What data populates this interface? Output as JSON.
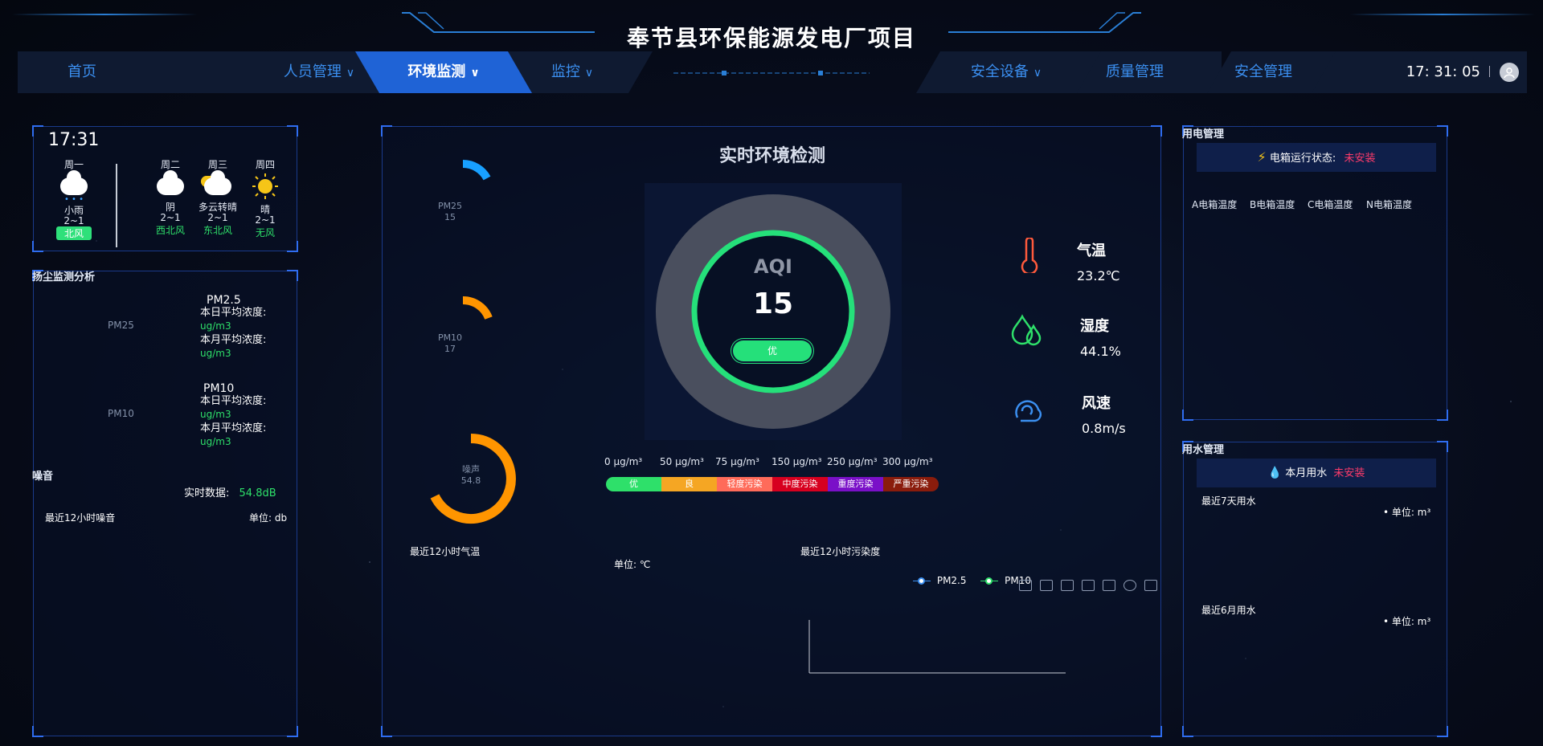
{
  "header": {
    "title": "奉节县环保能源发电厂项目",
    "time": "17: 31: 05",
    "nav": [
      {
        "label": "首页",
        "dropdown": false
      },
      {
        "label": "人员管理",
        "dropdown": true
      },
      {
        "label": "环境监测",
        "dropdown": true,
        "active": true
      },
      {
        "label": "监控",
        "dropdown": true
      },
      {
        "label": "安全设备",
        "dropdown": true
      },
      {
        "label": "质量管理",
        "dropdown": false
      },
      {
        "label": "安全管理",
        "dropdown": false
      }
    ]
  },
  "weather": {
    "time": "17:31",
    "today": {
      "day": "周一",
      "desc": "小雨",
      "temp": "2~1",
      "wind": "北风"
    },
    "forecast": [
      {
        "day": "周二",
        "desc": "阴",
        "temp": "2~1",
        "wind": "西北风"
      },
      {
        "day": "周三",
        "desc": "多云转晴",
        "temp": "2~1",
        "wind": "东北风"
      },
      {
        "day": "周四",
        "desc": "晴",
        "temp": "2~1",
        "wind": "无风"
      }
    ]
  },
  "dust": {
    "title": "扬尘监测分析",
    "pm25": {
      "gauge_label": "PM25",
      "name": "PM2.5",
      "day_label": "本日平均浓度:",
      "day_unit": "ug/m3",
      "month_label": "本月平均浓度:",
      "month_unit": "ug/m3"
    },
    "pm10": {
      "gauge_label": "PM10",
      "name": "PM10",
      "day_label": "本日平均浓度:",
      "day_unit": "ug/m3",
      "month_label": "本月平均浓度:",
      "month_unit": "ug/m3"
    }
  },
  "noise": {
    "title": "噪音",
    "realtime_label": "实时数据:",
    "realtime_value": "54.8dB",
    "chart_title": "最近12小时噪音",
    "unit": "单位: db"
  },
  "center": {
    "title": "实时环境检测",
    "gauges": [
      {
        "name": "PM25",
        "value": "15",
        "level": 0.15
      },
      {
        "name": "PM10",
        "value": "17",
        "level": 0.17
      },
      {
        "name": "噪声",
        "value": "54.8",
        "level": 0.548
      }
    ],
    "aqi": {
      "label": "AQI",
      "value": "15",
      "grade": "优"
    },
    "scale_labels": [
      "0 μg/m³",
      "50 μg/m³",
      "75 μg/m³",
      "150 μg/m³",
      "250 μg/m³",
      "300 μg/m³"
    ],
    "scale_grades": [
      {
        "label": "优",
        "color": "#2ee06a"
      },
      {
        "label": "良",
        "color": "#f5a623"
      },
      {
        "label": "轻度污染",
        "color": "#ff6b5a"
      },
      {
        "label": "中度污染",
        "color": "#d7001f"
      },
      {
        "label": "重度污染",
        "color": "#7a10c8"
      },
      {
        "label": "严重污染",
        "color": "#8a1c0c"
      }
    ],
    "weather_metrics": [
      {
        "label": "气温",
        "value": "23.2℃",
        "icon": "thermometer-icon"
      },
      {
        "label": "湿度",
        "value": "44.1%",
        "icon": "droplets-icon"
      },
      {
        "label": "风速",
        "value": "0.8m/s",
        "icon": "wind-icon"
      }
    ],
    "temp_chart": {
      "title": "最近12小时气温",
      "unit": "单位: ℃"
    },
    "pollution_chart": {
      "title": "最近12小时污染度",
      "legend": [
        "PM2.5",
        "PM10"
      ]
    }
  },
  "power": {
    "title": "用电管理",
    "status_label": "电箱运行状态:",
    "status_value": "未安装",
    "columns": [
      "A电箱温度",
      "B电箱温度",
      "C电箱温度",
      "N电箱温度"
    ]
  },
  "water": {
    "title": "用水管理",
    "month_label": "本月用水",
    "month_value": "未安装",
    "week_title": "最近7天用水",
    "week_unit": "单位: m³",
    "halfyear_title": "最近6月用水",
    "halfyear_unit": "单位: m³"
  },
  "colors": {
    "accent": "#1f63d6",
    "good": "#2ee06a",
    "warn": "#ff3b6b",
    "gauge_orange": "#ff9500",
    "gauge_blue": "#18a0ff"
  }
}
